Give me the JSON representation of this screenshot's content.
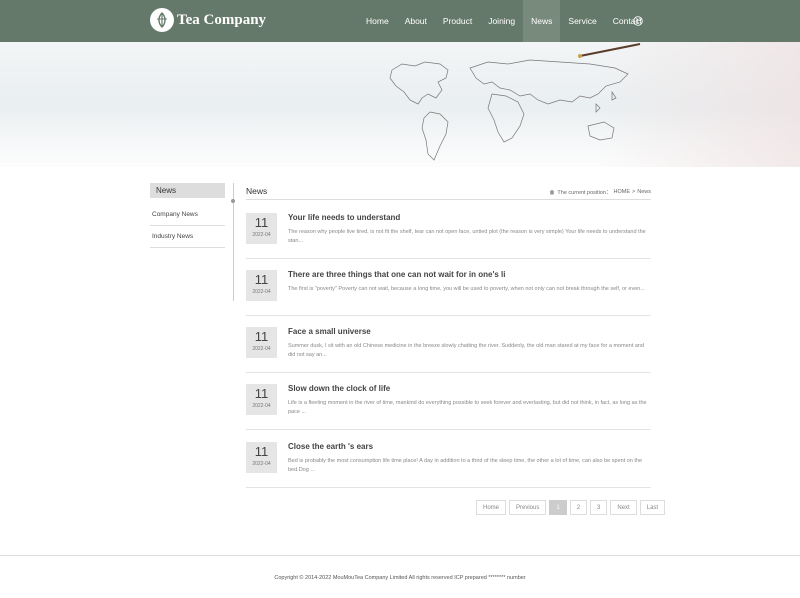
{
  "brand": {
    "name": "Tea Company",
    "logo_glyph": "茶"
  },
  "nav": {
    "items": [
      {
        "label": "Home",
        "active": false
      },
      {
        "label": "About",
        "active": false
      },
      {
        "label": "Product",
        "active": false
      },
      {
        "label": "Joining",
        "active": false
      },
      {
        "label": "News",
        "active": true
      },
      {
        "label": "Service",
        "active": false
      },
      {
        "label": "Contact",
        "active": false
      }
    ],
    "language_icon": "globe-icon"
  },
  "sidebar": {
    "title": "News",
    "items": [
      {
        "label": "Company News"
      },
      {
        "label": "Industry News"
      }
    ]
  },
  "content": {
    "title": "News",
    "breadcrumb": {
      "prefix": "The current position：",
      "home": "HOME",
      "separator": ">",
      "current": "News"
    }
  },
  "news": [
    {
      "day": "11",
      "ym": "2022-04",
      "title": "Your life needs to understand",
      "summary": "The reason why people live tired, is not fit the shelf, tear can not open face, untied plot (the reason is very simple) Your life needs to understand the stan..."
    },
    {
      "day": "11",
      "ym": "2022-04",
      "title": "There are three things that one can not wait for in one's li",
      "summary": "The first is \"poverty\" Poverty can not wait, because a long time, you will be used to poverty, when not only can not break through the self, or even..."
    },
    {
      "day": "11",
      "ym": "2022-04",
      "title": "Face a small universe",
      "summary": "Summer dusk, I sit with an old Chinese medicine in the breeze slowly chatting the river. Suddenly, the old man stared at my face for a moment and did not say an..."
    },
    {
      "day": "11",
      "ym": "2022-04",
      "title": "Slow down the clock of life",
      "summary": "Life is a fleeting moment in the river of time, mankind do everything possible to seek forever and everlasting, but did not think, in fact, as long as the pace ..."
    },
    {
      "day": "11",
      "ym": "2022-04",
      "title": "Close the earth 's ears",
      "summary": "Bed is probably the most consumption life time place! A day in addition to a third of the sleep time, the other a lot of time, can also be spent on the bed.Dog ..."
    }
  ],
  "pager": {
    "home": "Home",
    "prev": "Previous",
    "pages": [
      "1",
      "2",
      "3"
    ],
    "current": 1,
    "next": "Next",
    "last": "Last"
  },
  "footer": {
    "text": "Copyright © 2014-2022 MouMouTea Company Limited All rights reserved   ICP prepared ******** number"
  },
  "colors": {
    "header": "#65796a",
    "active_nav": "#778a7c",
    "sidebar_active": "#dddddd"
  }
}
